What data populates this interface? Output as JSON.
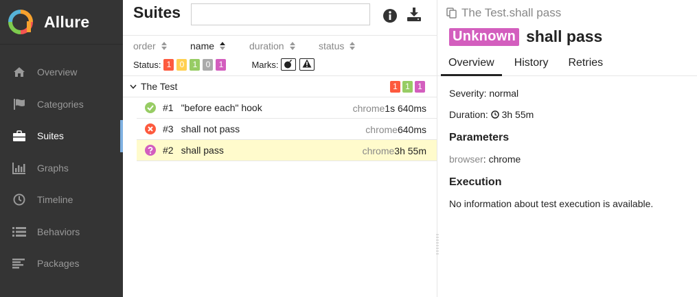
{
  "app": {
    "name": "Allure"
  },
  "sidebar": {
    "items": [
      {
        "label": "Overview",
        "icon": "home-icon"
      },
      {
        "label": "Categories",
        "icon": "flag-icon"
      },
      {
        "label": "Suites",
        "icon": "briefcase-icon",
        "active": true
      },
      {
        "label": "Graphs",
        "icon": "bar-chart-icon"
      },
      {
        "label": "Timeline",
        "icon": "clock-icon"
      },
      {
        "label": "Behaviors",
        "icon": "list-icon"
      },
      {
        "label": "Packages",
        "icon": "align-left-icon"
      }
    ]
  },
  "middle": {
    "title": "Suites",
    "search": {
      "value": "",
      "placeholder": ""
    },
    "sort": {
      "order": "order",
      "name": "name",
      "duration": "duration",
      "status": "status"
    },
    "filter": {
      "status_label": "Status:",
      "status_counts": [
        "1",
        "0",
        "1",
        "0",
        "1"
      ],
      "marks_label": "Marks:"
    },
    "group": {
      "name": "The Test",
      "counts": [
        "1",
        "1",
        "1"
      ]
    },
    "tests": [
      {
        "num": "#1",
        "name": "\"before each\" hook",
        "browser": "chrome",
        "duration": "1s 640ms",
        "status": "passed"
      },
      {
        "num": "#3",
        "name": "shall not pass",
        "browser": "chrome",
        "duration": "640ms",
        "status": "failed"
      },
      {
        "num": "#2",
        "name": "shall pass",
        "browser": "chrome",
        "duration": "3h 55m",
        "status": "unknown"
      }
    ]
  },
  "detail": {
    "crumb": "The Test.shall pass",
    "status_badge": "Unknown",
    "title": "shall pass",
    "tabs": [
      "Overview",
      "History",
      "Retries"
    ],
    "severity_label": "Severity:",
    "severity": "normal",
    "duration_label": "Duration:",
    "duration": "3h 55m",
    "parameters_heading": "Parameters",
    "param_name": "browser",
    "param_value": "chrome",
    "execution_heading": "Execution",
    "execution_text": "No information about test execution is available."
  },
  "colors": {
    "failed": "#fd5a3e",
    "broken": "#ffd050",
    "passed": "#97cc64",
    "skipped": "#aaaaaa",
    "unknown": "#d35ebe",
    "sidebar_bg": "#343434",
    "selected_row": "#fffbcc"
  }
}
